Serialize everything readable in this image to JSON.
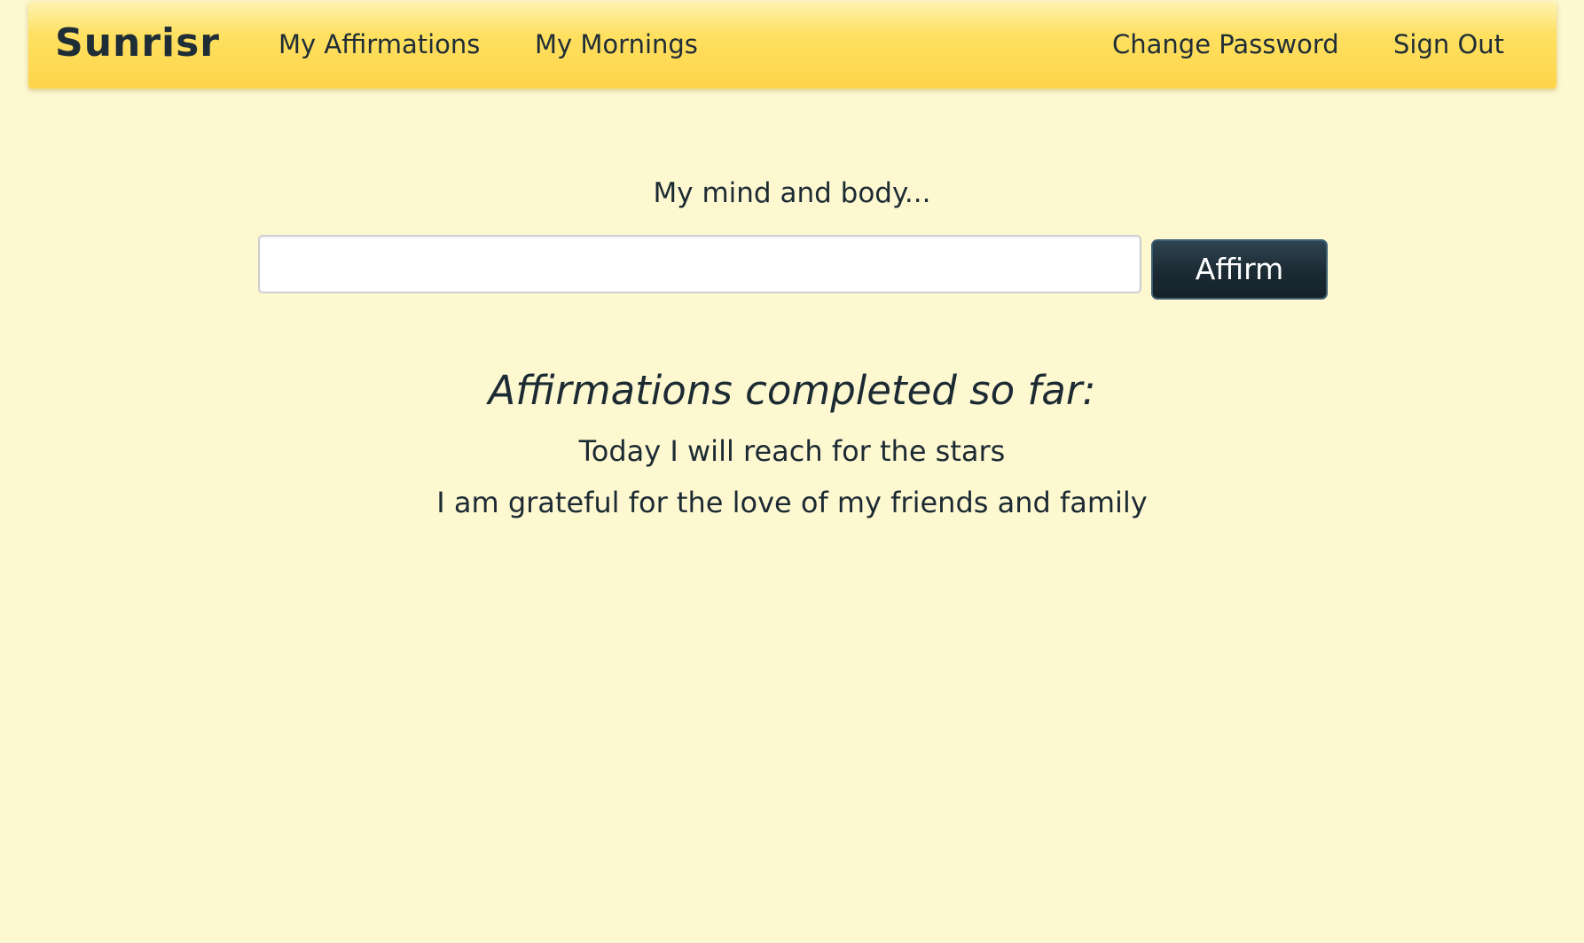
{
  "navbar": {
    "brand": "Sunrisr",
    "links_left": [
      {
        "label": "My Affirmations"
      },
      {
        "label": "My Mornings"
      }
    ],
    "links_right": [
      {
        "label": "Change Password"
      },
      {
        "label": "Sign Out"
      }
    ]
  },
  "form": {
    "prompt": "My mind and body...",
    "input_value": "",
    "input_placeholder": "",
    "button_label": "Affirm"
  },
  "completed": {
    "heading": "Affirmations completed so far:",
    "items": [
      "Today I will reach for the stars",
      "I am grateful for the love of my friends and family"
    ]
  },
  "colors": {
    "page_background": "#fdf8d0",
    "navbar": "#fed54a",
    "button": "#1b2a33",
    "text": "#1c2a33"
  }
}
